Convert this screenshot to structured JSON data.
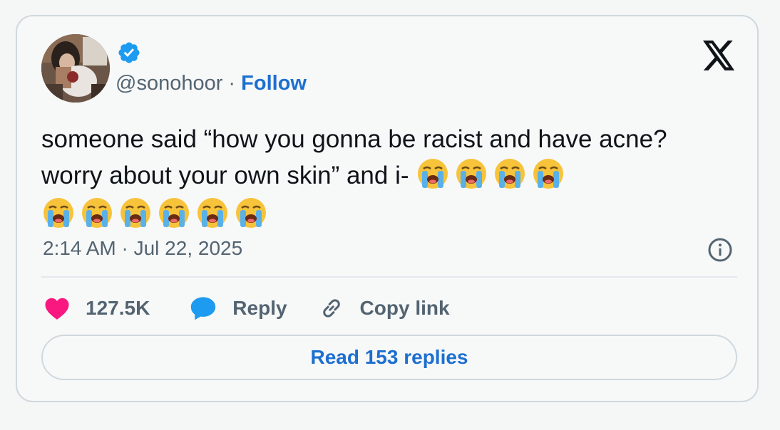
{
  "user": {
    "handle": "@sonohoor",
    "separator": " · ",
    "follow_label": "Follow",
    "verified": true
  },
  "tweet": {
    "text": "someone said “how you gonna be racist and have acne? worry about your own skin” and i-",
    "emoji": "loudly-crying-face",
    "emoji_count": 10,
    "timestamp": "2:14 AM · Jul 22, 2025"
  },
  "actions": {
    "like_count": "127.5K",
    "reply_label": "Reply",
    "copy_label": "Copy link"
  },
  "read_replies_label": "Read 153 replies",
  "colors": {
    "accent": "#1d6fd0",
    "like": "#f91880",
    "reply": "#1d9bf0",
    "verified": "#1d9bf0",
    "text": "#0f1419",
    "muted": "#536471",
    "border": "#cfd9de"
  },
  "icons": [
    "verified-badge-icon",
    "x-logo-icon",
    "info-icon",
    "heart-icon",
    "reply-bubble-icon",
    "link-icon",
    "loudly-crying-face-emoji"
  ]
}
